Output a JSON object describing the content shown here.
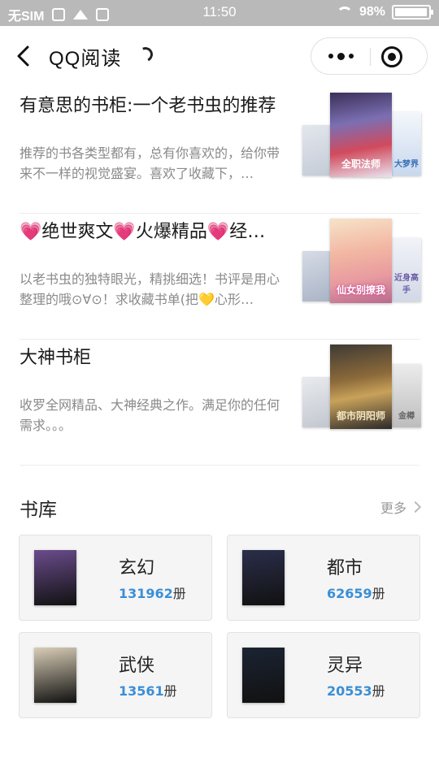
{
  "status_bar": {
    "carrier": "无SIM",
    "time": "11:50",
    "battery": "98%",
    "battery_level": 0.98
  },
  "nav": {
    "title": "QQ阅读",
    "back_icon": "chevron-left-icon",
    "more_icon": "more-dots-icon",
    "close_icon": "target-circle-icon"
  },
  "booklists": [
    {
      "title": "有意思的书柜:一个老书虫的推荐",
      "desc": "推荐的书各类型都有，总有你喜欢的，给你带来不一样的视觉盛宴。喜欢了收藏下，…",
      "main_cover_text": "全职法师",
      "right_cover_text": "大梦界"
    },
    {
      "title_parts": [
        "💗",
        "绝世爽文",
        "💗",
        "火爆精品",
        "💗",
        "经…"
      ],
      "desc_parts": [
        "以老书虫的独特眼光，精挑细选！书评是用心整理的哦⊙∀⊙！求收藏书单(把",
        "💛",
        "心形…"
      ],
      "main_cover_text": "仙女别撩我",
      "right_cover_text": "近身高手"
    },
    {
      "title": "大神书柜",
      "desc": "收罗全网精品、大神经典之作。满足你的任何需求。。。",
      "main_cover_text": "都市阴阳师",
      "right_cover_text": "金樽"
    }
  ],
  "library": {
    "title": "书库",
    "more": "更多",
    "unit": "册",
    "categories": [
      {
        "name": "玄幻",
        "count": "131962",
        "cover_color": "#6a4c8c"
      },
      {
        "name": "都市",
        "count": "62659",
        "cover_color": "#2a2e4a"
      },
      {
        "name": "武侠",
        "count": "13561",
        "cover_color": "#d8cdb6"
      },
      {
        "name": "灵异",
        "count": "20553",
        "cover_color": "#1b2433"
      }
    ]
  }
}
